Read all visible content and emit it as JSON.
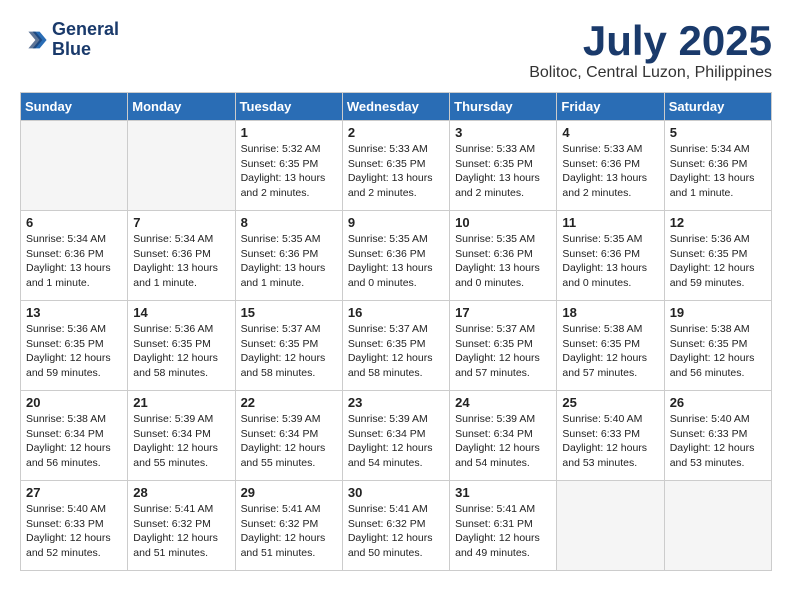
{
  "header": {
    "logo_line1": "General",
    "logo_line2": "Blue",
    "month": "July 2025",
    "location": "Bolitoc, Central Luzon, Philippines"
  },
  "days_of_week": [
    "Sunday",
    "Monday",
    "Tuesday",
    "Wednesday",
    "Thursday",
    "Friday",
    "Saturday"
  ],
  "weeks": [
    [
      {
        "day": "",
        "info": ""
      },
      {
        "day": "",
        "info": ""
      },
      {
        "day": "1",
        "info": "Sunrise: 5:32 AM\nSunset: 6:35 PM\nDaylight: 13 hours and 2 minutes."
      },
      {
        "day": "2",
        "info": "Sunrise: 5:33 AM\nSunset: 6:35 PM\nDaylight: 13 hours and 2 minutes."
      },
      {
        "day": "3",
        "info": "Sunrise: 5:33 AM\nSunset: 6:35 PM\nDaylight: 13 hours and 2 minutes."
      },
      {
        "day": "4",
        "info": "Sunrise: 5:33 AM\nSunset: 6:36 PM\nDaylight: 13 hours and 2 minutes."
      },
      {
        "day": "5",
        "info": "Sunrise: 5:34 AM\nSunset: 6:36 PM\nDaylight: 13 hours and 1 minute."
      }
    ],
    [
      {
        "day": "6",
        "info": "Sunrise: 5:34 AM\nSunset: 6:36 PM\nDaylight: 13 hours and 1 minute."
      },
      {
        "day": "7",
        "info": "Sunrise: 5:34 AM\nSunset: 6:36 PM\nDaylight: 13 hours and 1 minute."
      },
      {
        "day": "8",
        "info": "Sunrise: 5:35 AM\nSunset: 6:36 PM\nDaylight: 13 hours and 1 minute."
      },
      {
        "day": "9",
        "info": "Sunrise: 5:35 AM\nSunset: 6:36 PM\nDaylight: 13 hours and 0 minutes."
      },
      {
        "day": "10",
        "info": "Sunrise: 5:35 AM\nSunset: 6:36 PM\nDaylight: 13 hours and 0 minutes."
      },
      {
        "day": "11",
        "info": "Sunrise: 5:35 AM\nSunset: 6:36 PM\nDaylight: 13 hours and 0 minutes."
      },
      {
        "day": "12",
        "info": "Sunrise: 5:36 AM\nSunset: 6:35 PM\nDaylight: 12 hours and 59 minutes."
      }
    ],
    [
      {
        "day": "13",
        "info": "Sunrise: 5:36 AM\nSunset: 6:35 PM\nDaylight: 12 hours and 59 minutes."
      },
      {
        "day": "14",
        "info": "Sunrise: 5:36 AM\nSunset: 6:35 PM\nDaylight: 12 hours and 58 minutes."
      },
      {
        "day": "15",
        "info": "Sunrise: 5:37 AM\nSunset: 6:35 PM\nDaylight: 12 hours and 58 minutes."
      },
      {
        "day": "16",
        "info": "Sunrise: 5:37 AM\nSunset: 6:35 PM\nDaylight: 12 hours and 58 minutes."
      },
      {
        "day": "17",
        "info": "Sunrise: 5:37 AM\nSunset: 6:35 PM\nDaylight: 12 hours and 57 minutes."
      },
      {
        "day": "18",
        "info": "Sunrise: 5:38 AM\nSunset: 6:35 PM\nDaylight: 12 hours and 57 minutes."
      },
      {
        "day": "19",
        "info": "Sunrise: 5:38 AM\nSunset: 6:35 PM\nDaylight: 12 hours and 56 minutes."
      }
    ],
    [
      {
        "day": "20",
        "info": "Sunrise: 5:38 AM\nSunset: 6:34 PM\nDaylight: 12 hours and 56 minutes."
      },
      {
        "day": "21",
        "info": "Sunrise: 5:39 AM\nSunset: 6:34 PM\nDaylight: 12 hours and 55 minutes."
      },
      {
        "day": "22",
        "info": "Sunrise: 5:39 AM\nSunset: 6:34 PM\nDaylight: 12 hours and 55 minutes."
      },
      {
        "day": "23",
        "info": "Sunrise: 5:39 AM\nSunset: 6:34 PM\nDaylight: 12 hours and 54 minutes."
      },
      {
        "day": "24",
        "info": "Sunrise: 5:39 AM\nSunset: 6:34 PM\nDaylight: 12 hours and 54 minutes."
      },
      {
        "day": "25",
        "info": "Sunrise: 5:40 AM\nSunset: 6:33 PM\nDaylight: 12 hours and 53 minutes."
      },
      {
        "day": "26",
        "info": "Sunrise: 5:40 AM\nSunset: 6:33 PM\nDaylight: 12 hours and 53 minutes."
      }
    ],
    [
      {
        "day": "27",
        "info": "Sunrise: 5:40 AM\nSunset: 6:33 PM\nDaylight: 12 hours and 52 minutes."
      },
      {
        "day": "28",
        "info": "Sunrise: 5:41 AM\nSunset: 6:32 PM\nDaylight: 12 hours and 51 minutes."
      },
      {
        "day": "29",
        "info": "Sunrise: 5:41 AM\nSunset: 6:32 PM\nDaylight: 12 hours and 51 minutes."
      },
      {
        "day": "30",
        "info": "Sunrise: 5:41 AM\nSunset: 6:32 PM\nDaylight: 12 hours and 50 minutes."
      },
      {
        "day": "31",
        "info": "Sunrise: 5:41 AM\nSunset: 6:31 PM\nDaylight: 12 hours and 49 minutes."
      },
      {
        "day": "",
        "info": ""
      },
      {
        "day": "",
        "info": ""
      }
    ]
  ]
}
